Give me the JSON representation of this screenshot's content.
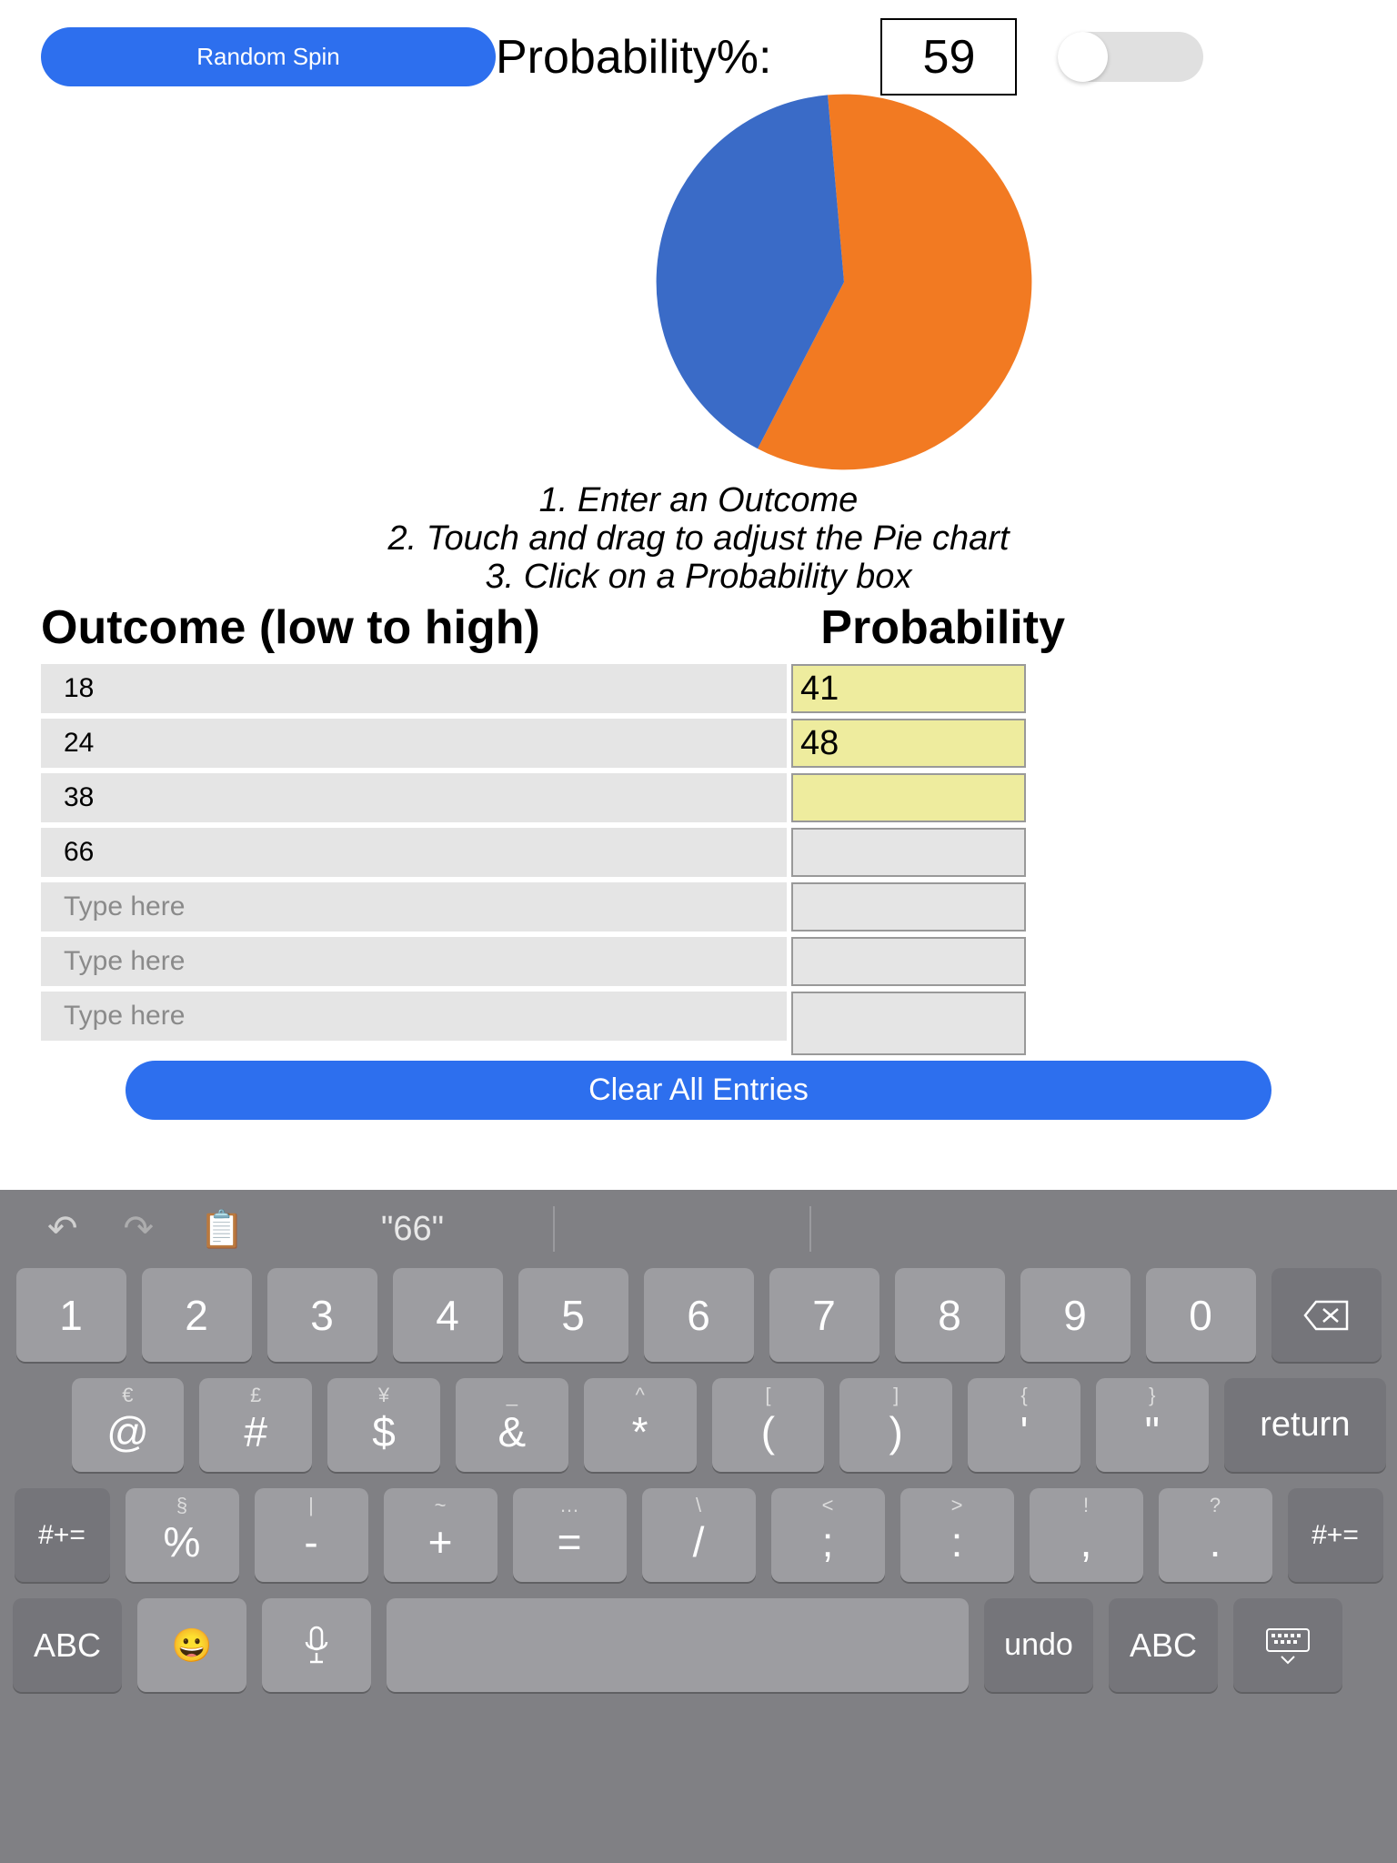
{
  "top": {
    "random_spin": "Random Spin",
    "prob_label": "Probability%:",
    "prob_value": "59"
  },
  "chart_data": {
    "type": "pie",
    "values": [
      59,
      41
    ],
    "colors": [
      "#f27a22",
      "#3a6bc7"
    ],
    "title": "",
    "start_angle_deg": -5
  },
  "instructions": {
    "l1": "1. Enter an Outcome",
    "l2": "2. Touch and drag to adjust the Pie chart",
    "l3": "3. Click on a Probability box"
  },
  "headers": {
    "outcome": "Outcome (low to high)",
    "prob": "Probability"
  },
  "rows": [
    {
      "outcome": "18",
      "prob": "41",
      "yellow": true
    },
    {
      "outcome": "24",
      "prob": "48",
      "yellow": true
    },
    {
      "outcome": "38",
      "prob": "",
      "yellow": true
    },
    {
      "outcome": "66",
      "prob": "",
      "yellow": false
    },
    {
      "outcome": "",
      "placeholder": "Type here",
      "prob": "",
      "yellow": false
    },
    {
      "outcome": "",
      "placeholder": "Type here",
      "prob": "",
      "yellow": false
    },
    {
      "outcome": "",
      "placeholder": "Type here",
      "prob": "",
      "yellow": false,
      "last": true
    }
  ],
  "clear_label": "Clear All Entries",
  "keyboard": {
    "suggestion": "\"66\"",
    "row1": [
      "1",
      "2",
      "3",
      "4",
      "5",
      "6",
      "7",
      "8",
      "9",
      "0"
    ],
    "row2": [
      {
        "sec": "€",
        "main": "@"
      },
      {
        "sec": "£",
        "main": "#"
      },
      {
        "sec": "¥",
        "main": "$"
      },
      {
        "sec": "_",
        "main": "&"
      },
      {
        "sec": "^",
        "main": "*"
      },
      {
        "sec": "[",
        "main": "("
      },
      {
        "sec": "]",
        "main": ")"
      },
      {
        "sec": "{",
        "main": "'"
      },
      {
        "sec": "}",
        "main": "\""
      }
    ],
    "return": "return",
    "row3_side": "#+=",
    "row3": [
      {
        "sec": "§",
        "main": "%"
      },
      {
        "sec": "|",
        "main": "-"
      },
      {
        "sec": "~",
        "main": "+"
      },
      {
        "sec": "…",
        "main": "="
      },
      {
        "sec": "\\",
        "main": "/"
      },
      {
        "sec": "<",
        "main": ";"
      },
      {
        "sec": ">",
        "main": ":"
      },
      {
        "sec": "!",
        "main": ","
      },
      {
        "sec": "?",
        "main": "."
      }
    ],
    "abc": "ABC",
    "undo": "undo"
  }
}
